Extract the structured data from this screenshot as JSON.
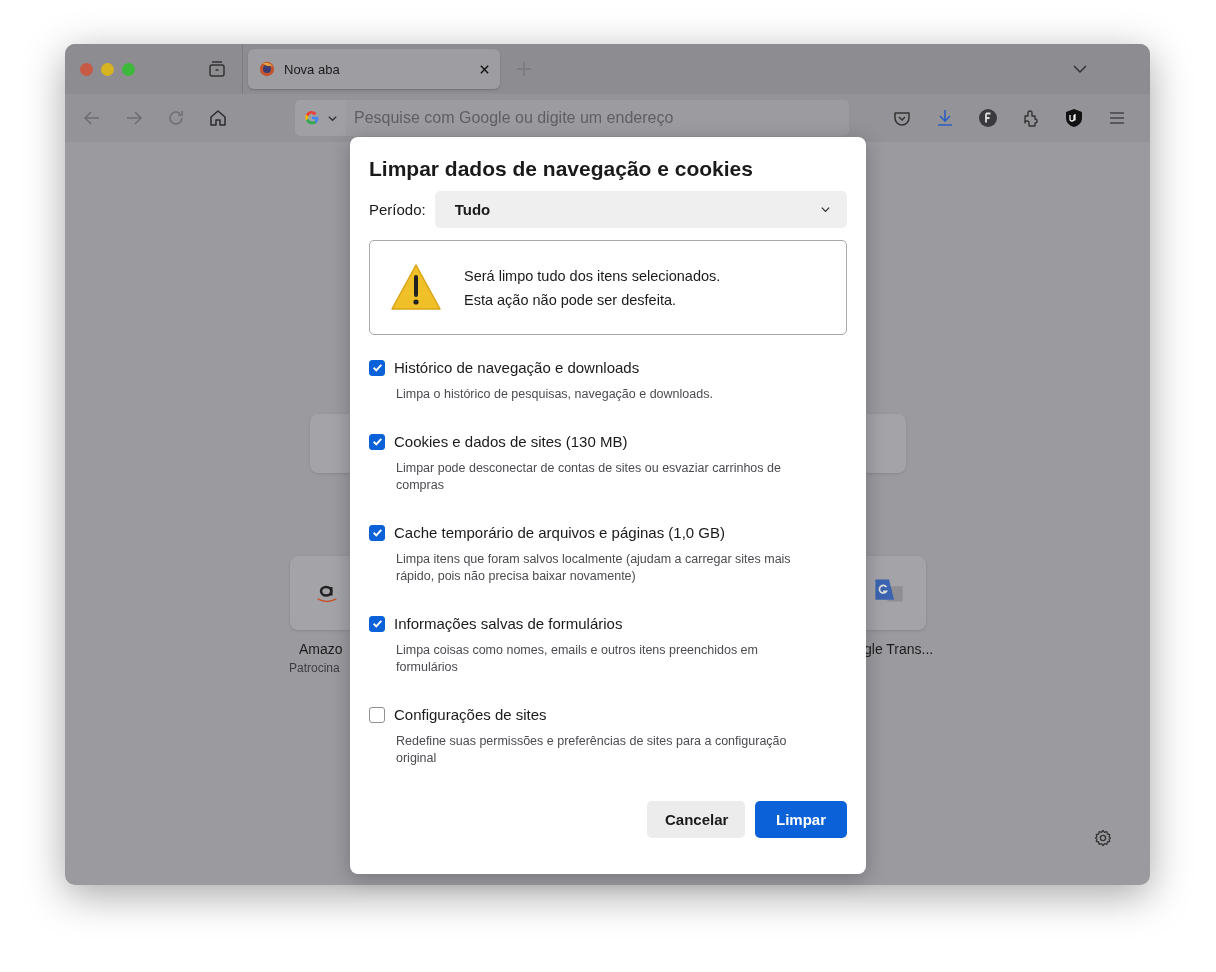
{
  "tabs": [
    {
      "label": "Nova aba",
      "selected": true
    }
  ],
  "address_bar": {
    "placeholder": "Pesquise com Google ou digite um endereço"
  },
  "shortcuts": [
    {
      "title": "Amazo",
      "subtitle": "Patrocina",
      "kind": "store"
    },
    {
      "title": "gle Trans...",
      "kind": "translate"
    }
  ],
  "dialog": {
    "title": "Limpar dados de navegação e cookies",
    "period_label": "Período:",
    "period_value": "Tudo",
    "warning": [
      "Será limpo tudo dos itens selecionados.",
      "Esta ação não pode ser desfeita."
    ],
    "options": [
      {
        "label": "Histórico de navegação e downloads",
        "description": "Limpa o histórico de pesquisas, navegação e downloads.",
        "checked": true
      },
      {
        "label": "Cookies e dados de sites (130 MB)",
        "description": "Limpar pode desconectar de contas de sites ou esvaziar carrinhos de compras",
        "checked": true
      },
      {
        "label": "Cache temporário de arquivos e páginas (1,0 GB)",
        "description": "Limpa itens que foram salvos localmente (ajudam a carregar sites mais rápido, pois não precisa baixar novamente)",
        "checked": true
      },
      {
        "label": "Informações salvas de formulários",
        "description": "Limpa coisas como nomes, emails e outros itens preenchidos em formulários",
        "checked": true
      },
      {
        "label": "Configurações de sites",
        "description": "Redefine suas permissões e preferências de sites para a configuração original",
        "checked": false
      }
    ],
    "buttons": [
      {
        "label": "Cancelar",
        "kind": "secondary"
      },
      {
        "label": "Limpar",
        "kind": "primary"
      }
    ]
  }
}
